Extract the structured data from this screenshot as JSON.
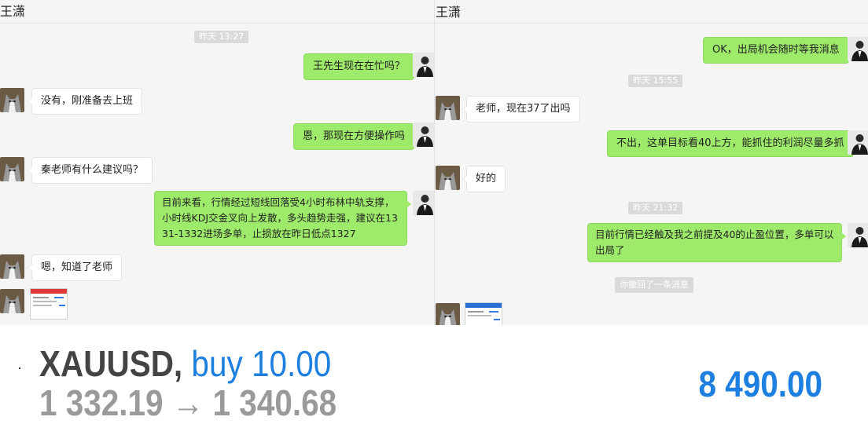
{
  "left": {
    "title": "王潇",
    "timestamp": "昨天 13:27",
    "messages": [
      {
        "text": "王先生现在在忙吗？"
      },
      {
        "text": "没有，刚准备去上班"
      },
      {
        "text": "恩，那现在方便操作吗"
      },
      {
        "text": "秦老师有什么建议吗？"
      },
      {
        "lines": [
          "目前来看，行情经过短线回落受4小时布林中轨支撑，",
          "小时线KDJ交金叉向上发散，多头趋势走强，建议在13",
          "31-1332进场多单，止损放在昨日低点1327"
        ]
      },
      {
        "text": "嗯，知道了老师"
      }
    ]
  },
  "right": {
    "title": "王潇",
    "messages": [
      {
        "text": "OK，出局机会随时等我消息"
      },
      {
        "timestamp": "昨天 15:55"
      },
      {
        "text": "老师，现在37了出吗"
      },
      {
        "text": "不出，这单目标看40上方，能抓住的利润尽量多抓"
      },
      {
        "text": "好的"
      },
      {
        "timestamp": "昨天 21:32"
      },
      {
        "lines": [
          "目前行情已经触及我之前提及40的止盈位置，多单可以",
          "出局了"
        ]
      },
      {
        "notice": "你撤回了一条消息"
      }
    ]
  },
  "ticker": {
    "symbol": "XAUUSD,",
    "action": "buy 10.00",
    "open_price": "1 332.19",
    "arrow": "→",
    "close_price": "1 340.68",
    "profit": "8 490.00"
  },
  "colors": {
    "outgoing_bubble": "#9eea6a",
    "incoming_bubble": "#ffffff",
    "profit_blue": "#1d7fe0"
  },
  "icons": {
    "contact_avatar": "husky-dog-avatar",
    "user_avatar": "man-in-suit-avatar",
    "attachment": "trading-app-screenshot-thumbnail"
  }
}
